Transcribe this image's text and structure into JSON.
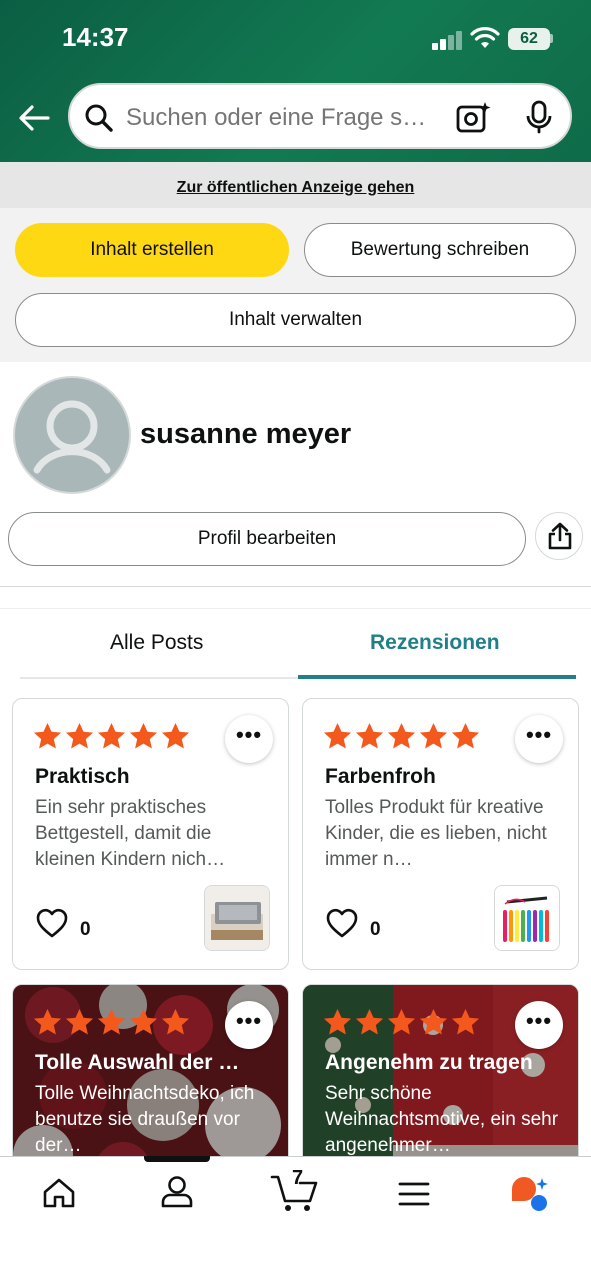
{
  "status": {
    "time": "14:37",
    "battery": "62"
  },
  "search": {
    "placeholder": "Suchen oder eine Frage s…"
  },
  "banner": {
    "link": "Zur öffentlichen Anzeige gehen"
  },
  "actions": {
    "create": "Inhalt erstellen",
    "review": "Bewertung schreiben",
    "manage": "Inhalt verwalten"
  },
  "profile": {
    "name": "susanne meyer",
    "edit": "Profil bearbeiten"
  },
  "tabs": [
    {
      "label": "Alle Posts"
    },
    {
      "label": "Rezensionen",
      "active": true
    }
  ],
  "cards": [
    {
      "title": "Praktisch",
      "text": "Ein sehr praktisches Bettgestell, damit die kleinen Kindern nich…",
      "rating": 5,
      "likes": "0"
    },
    {
      "title": "Farbenfroh",
      "text": "Tolles Produkt für kreative Kinder, die es lieben, nicht immer n…",
      "rating": 5,
      "likes": "0"
    },
    {
      "title": "Tolle Auswahl der …",
      "text": "Tolle Weihnachtsdeko, ich benutze sie draußen vor der…",
      "rating": 5
    },
    {
      "title": "Angenehm zu tragen",
      "text": "Sehr schöne Weihnachtsmotive, ein sehr angenehmer…",
      "rating": 5
    }
  ],
  "nav": {
    "cart_count": "7"
  },
  "colors": {
    "header": "#0b5e43",
    "primary_button": "#ffd814",
    "accent": "#207f87",
    "star": "#f3591c"
  }
}
